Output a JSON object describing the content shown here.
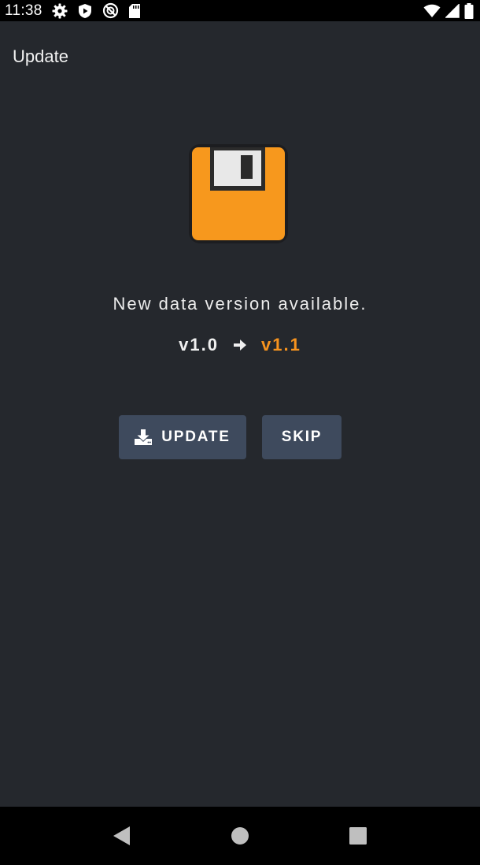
{
  "status_bar": {
    "time": "11:38",
    "icons_left": [
      "gear-icon",
      "play-protect-icon",
      "no-disturb-icon",
      "sd-card-icon"
    ],
    "icons_right": [
      "wifi-icon",
      "signal-icon",
      "battery-icon"
    ]
  },
  "app": {
    "title": "Update",
    "message": "New data version available.",
    "version_current": "v1.0",
    "version_new": "v1.1",
    "update_label": "UPDATE",
    "skip_label": "SKIP"
  },
  "colors": {
    "background": "#25282d",
    "accent": "#f7931e",
    "button": "#3e4a5d"
  },
  "nav_bar": {
    "icons": [
      "back-icon",
      "home-icon",
      "recents-icon"
    ]
  }
}
